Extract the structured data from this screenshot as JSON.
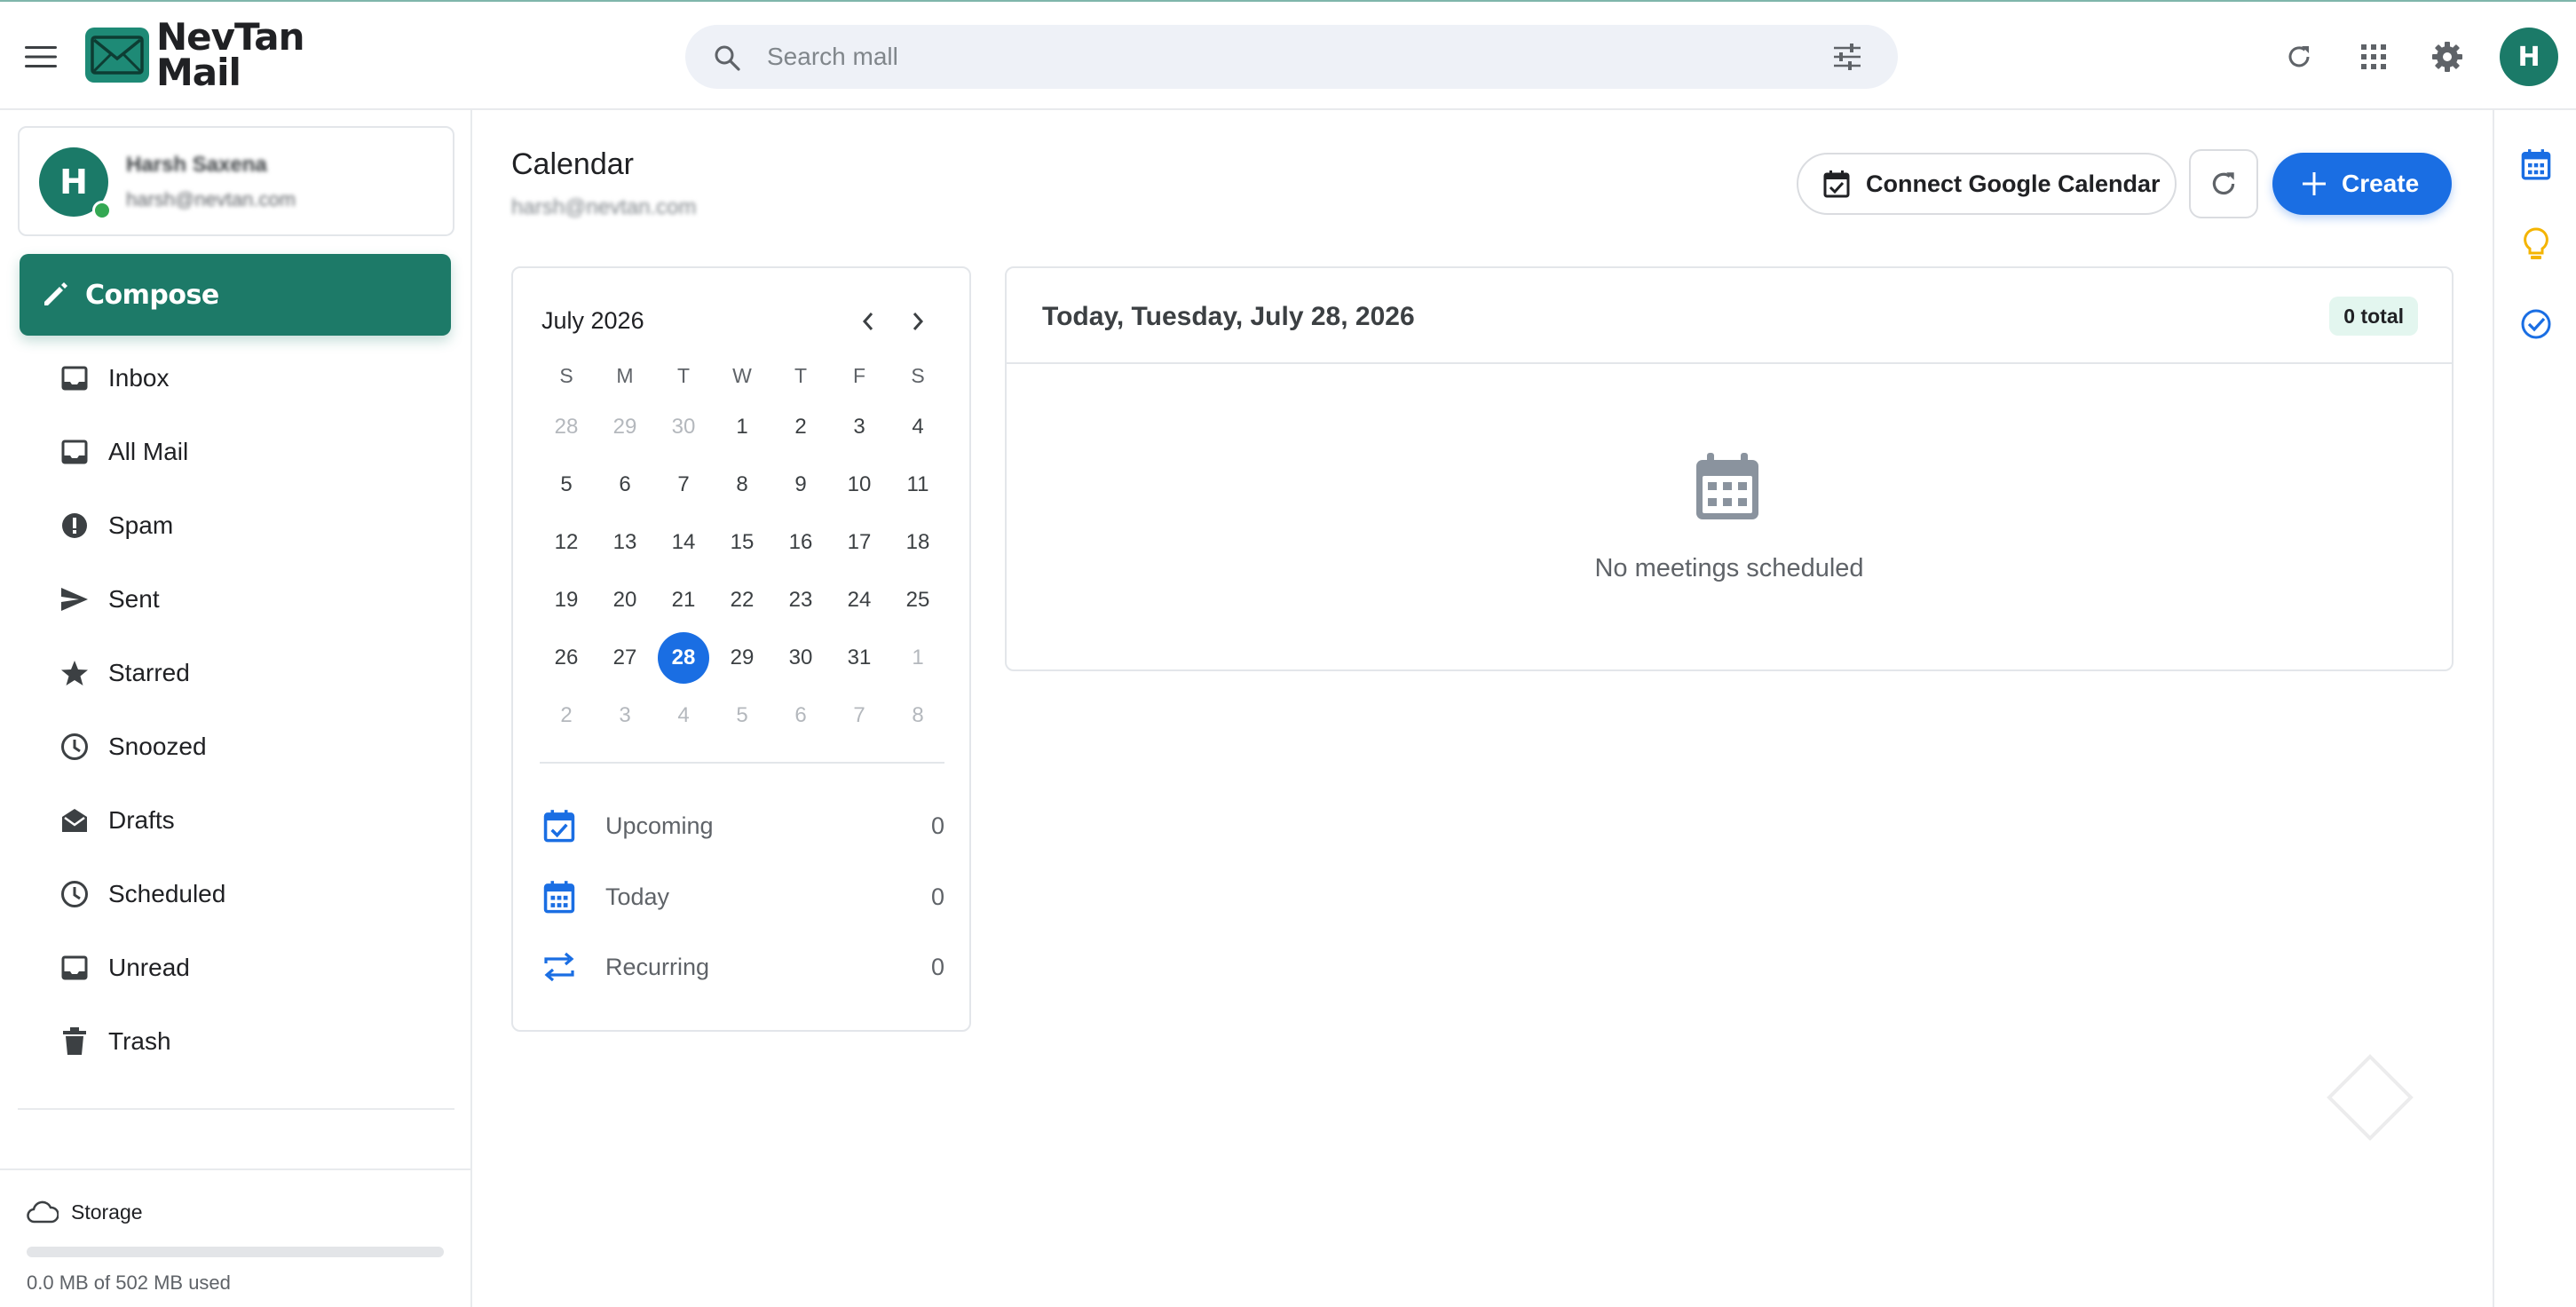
{
  "header": {
    "brand_line1": "NevTan",
    "brand_line2": "Mail",
    "search_placeholder": "Search mall",
    "avatar_initial": "H",
    "icons": [
      "menu-icon",
      "search-icon",
      "tune-icon",
      "refresh-icon",
      "apps-icon",
      "gear-icon"
    ]
  },
  "account": {
    "initial": "H",
    "name": "Harsh Saxena",
    "email": "harsh@nevtan.com",
    "status_color": "#34a853"
  },
  "sidebar": {
    "compose_label": "Compose",
    "items": [
      {
        "label": "Inbox",
        "icon": "inbox-icon"
      },
      {
        "label": "All Mail",
        "icon": "all-mail-icon"
      },
      {
        "label": "Spam",
        "icon": "spam-icon"
      },
      {
        "label": "Sent",
        "icon": "send-icon"
      },
      {
        "label": "Starred",
        "icon": "star-icon"
      },
      {
        "label": "Snoozed",
        "icon": "clock-icon"
      },
      {
        "label": "Drafts",
        "icon": "drafts-icon"
      },
      {
        "label": "Scheduled",
        "icon": "schedule-icon"
      },
      {
        "label": "Unread",
        "icon": "unread-icon"
      },
      {
        "label": "Trash",
        "icon": "trash-icon"
      }
    ]
  },
  "storage": {
    "label": "Storage",
    "used_text": "0.0 MB of 502 MB used",
    "used_fraction": 0.0
  },
  "main": {
    "title": "Calendar",
    "email": "harsh@nevtan.com",
    "connect_label": "Connect Google Calendar",
    "create_label": "Create"
  },
  "mini_calendar": {
    "month_label": "July 2026",
    "weekdays": [
      "S",
      "M",
      "T",
      "W",
      "T",
      "F",
      "S"
    ],
    "weeks": [
      [
        "28",
        "29",
        "30",
        "1",
        "2",
        "3",
        "4"
      ],
      [
        "5",
        "6",
        "7",
        "8",
        "9",
        "10",
        "11"
      ],
      [
        "12",
        "13",
        "14",
        "15",
        "16",
        "17",
        "18"
      ],
      [
        "19",
        "20",
        "21",
        "22",
        "23",
        "24",
        "25"
      ],
      [
        "26",
        "27",
        "28",
        "29",
        "30",
        "31",
        "1"
      ],
      [
        "2",
        "3",
        "4",
        "5",
        "6",
        "7",
        "8"
      ]
    ],
    "selected_day": "28",
    "stats": [
      {
        "label": "Upcoming",
        "count": "0",
        "icon": "calendar-check-icon"
      },
      {
        "label": "Today",
        "count": "0",
        "icon": "calendar-grid-icon"
      },
      {
        "label": "Recurring",
        "count": "0",
        "icon": "repeat-icon"
      }
    ]
  },
  "agenda": {
    "title": "Today, Tuesday, July 28, 2026",
    "total_badge": "0 total",
    "empty_text": "No meetings scheduled"
  },
  "rail": {
    "icons": [
      "calendar-icon",
      "lightbulb-icon",
      "tasks-icon"
    ]
  },
  "colors": {
    "brand": "#1d7a68",
    "accent_blue": "#1a6ee3",
    "keep_yellow": "#f4b400",
    "muted_text": "#5f6368"
  }
}
